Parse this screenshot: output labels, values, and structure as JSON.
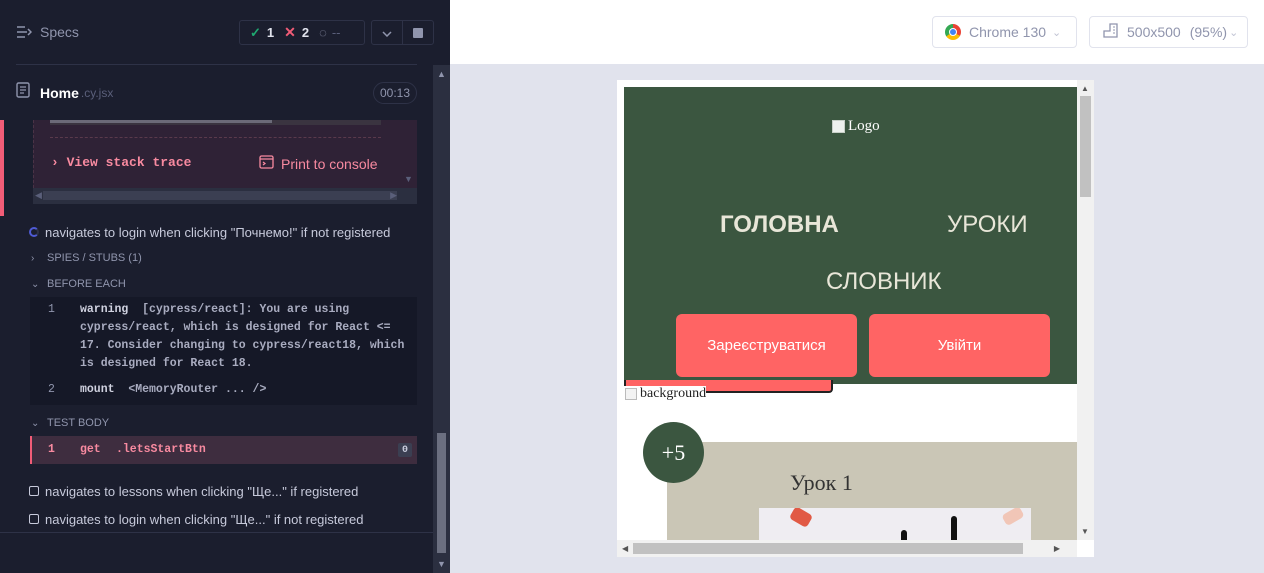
{
  "header": {
    "specs_label": "Specs",
    "stats": {
      "passed": "1",
      "failed": "2",
      "pending": "--"
    }
  },
  "spec": {
    "name": "Home",
    "ext": ".cy.jsx",
    "duration": "00:13"
  },
  "error": {
    "stack_trace_label": "View stack trace",
    "print_label": "Print to console"
  },
  "tests": {
    "running": {
      "title": "navigates to login when clicking \"Почнемо!\" if not registered"
    },
    "spies_label": "SPIES / STUBS (1)",
    "before_each_label": "BEFORE EACH",
    "before_each_commands": [
      {
        "num": "1",
        "name": "warning",
        "message": "[cypress/react]: You are using cypress/react, which is designed for React <= 17. Consider changing to cypress/react18, which is designed for React 18."
      },
      {
        "num": "2",
        "name": "mount",
        "message": "<MemoryRouter ... />"
      }
    ],
    "test_body_label": "TEST BODY",
    "test_body_commands": [
      {
        "num": "1",
        "name": "get",
        "selector": ".letsStartBtn",
        "count": "0"
      }
    ],
    "others": [
      {
        "title": "navigates to lessons when clicking \"Ще...\" if registered"
      },
      {
        "title": "navigates to login when clicking \"Ще...\" if not registered"
      }
    ]
  },
  "aut": {
    "browser": "Chrome 130",
    "viewport_size": "500x500",
    "zoom": "(95%)"
  },
  "site": {
    "logo_alt": "Logo",
    "nav": [
      "ГОЛОВНА",
      "УРОКИ",
      "СЛОВНИК"
    ],
    "register_button": "Зареєструватися",
    "login_button": "Увійти",
    "background_alt": "background",
    "badge": "+5",
    "lesson_title": "Урок 1"
  },
  "colors": {
    "accent_pass": "#1fa971",
    "accent_fail": "#f25c77",
    "site_green": "#3b5640",
    "site_red": "#ff6464"
  }
}
